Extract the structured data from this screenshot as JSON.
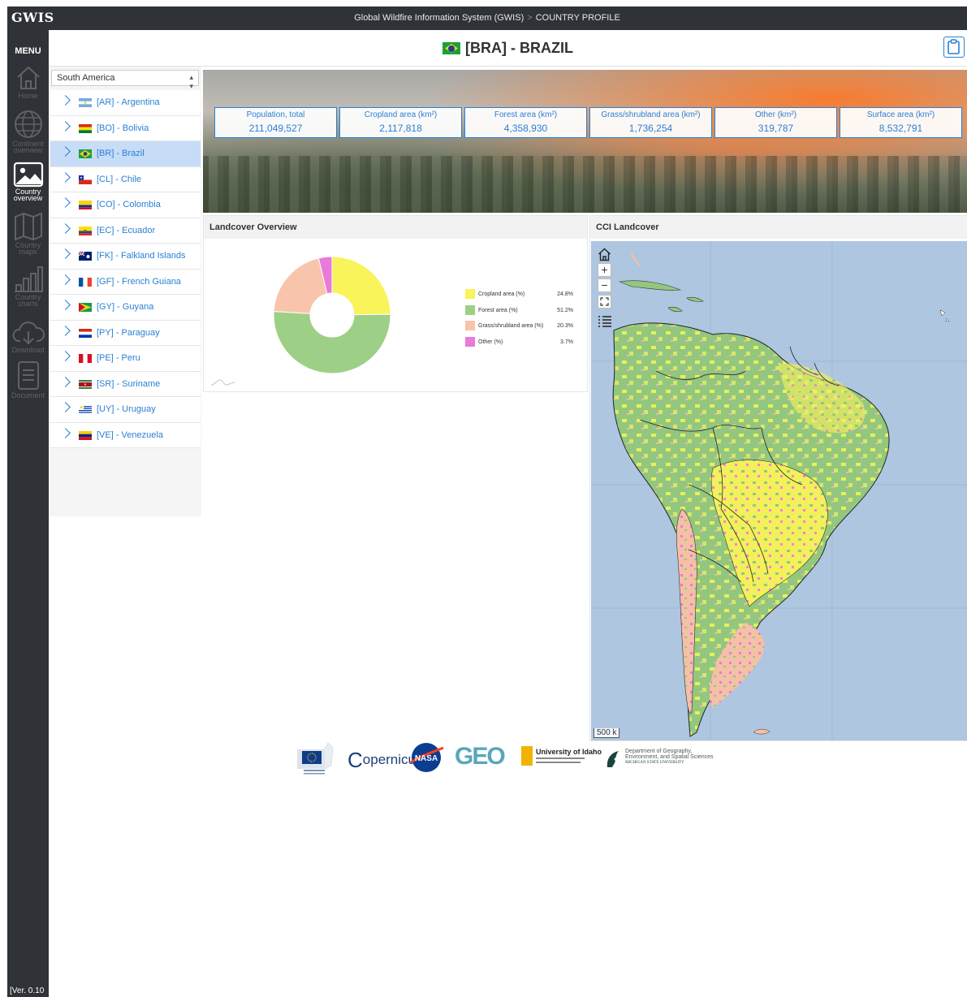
{
  "topbar": {
    "brand": "GWIS",
    "crumb_main": "Global Wildfire Information System (GWIS)",
    "crumb_sep": ">",
    "crumb_current": "COUNTRY PROFILE"
  },
  "sidebar": {
    "menu_label": "MENU",
    "items": [
      {
        "line1": "Home",
        "line2": "",
        "icon": "home-icon",
        "active": false
      },
      {
        "line1": "Continent",
        "line2": "overview",
        "icon": "globe-icon",
        "active": false
      },
      {
        "line1": "Country",
        "line2": "overview",
        "icon": "image-icon",
        "active": true
      },
      {
        "line1": "Country",
        "line2": "maps",
        "icon": "map-icon",
        "active": false
      },
      {
        "line1": "Country",
        "line2": "charts",
        "icon": "bar-chart-icon",
        "active": false
      },
      {
        "line1": "Download",
        "line2": "",
        "icon": "download-icon",
        "active": false
      },
      {
        "line1": "Document",
        "line2": "",
        "icon": "document-icon",
        "active": false
      }
    ],
    "version": "[Ver. 0.10"
  },
  "header": {
    "title": "[BRA] - BRAZIL"
  },
  "region_select": {
    "value": "South America"
  },
  "countries": [
    {
      "label": "[AR] - Argentina",
      "active": false
    },
    {
      "label": "[BO] - Bolivia",
      "active": false
    },
    {
      "label": "[BR] - Brazil",
      "active": true
    },
    {
      "label": "[CL] - Chile",
      "active": false
    },
    {
      "label": "[CO] - Colombia",
      "active": false
    },
    {
      "label": "[EC] - Ecuador",
      "active": false
    },
    {
      "label": "[FK] - Falkland Islands",
      "active": false
    },
    {
      "label": "[GF] - French Guiana",
      "active": false
    },
    {
      "label": "[GY] - Guyana",
      "active": false
    },
    {
      "label": "[PY] - Paraguay",
      "active": false
    },
    {
      "label": "[PE] - Peru",
      "active": false
    },
    {
      "label": "[SR] - Suriname",
      "active": false
    },
    {
      "label": "[UY] - Uruguay",
      "active": false
    },
    {
      "label": "[VE] - Venezuela",
      "active": false
    }
  ],
  "stats": [
    {
      "label": "Population, total",
      "value": "211,049,527"
    },
    {
      "label": "Cropland area (km²)",
      "value": "2,117,818"
    },
    {
      "label": "Forest area (km²)",
      "value": "4,358,930"
    },
    {
      "label": "Grass/shrubland area (km²)",
      "value": "1,736,254"
    },
    {
      "label": "Other (km²)",
      "value": "319,787"
    },
    {
      "label": "Surface area (km²)",
      "value": "8,532,791"
    }
  ],
  "landcover_card": {
    "title": "Landcover Overview"
  },
  "map_card": {
    "title": "CCI Landcover",
    "scale_label": "500 k"
  },
  "chart_data": {
    "type": "pie",
    "categories": [
      "Cropland area (%)",
      "Forest area (%)",
      "Grass/shrubland area (%)",
      "Other (%)"
    ],
    "values": [
      24.8,
      51.2,
      20.3,
      3.7
    ],
    "value_labels": [
      "24.8%",
      "51.2%",
      "20.3%",
      "3.7%"
    ],
    "colors": [
      "#f8f45a",
      "#9ecf86",
      "#f8c4ab",
      "#e97ad9"
    ],
    "donut": true,
    "legend": "right"
  },
  "footer_logos": {
    "copernicus": "opernicus",
    "nasa": "NASA",
    "geo": "GEO",
    "idaho": "University of Idaho",
    "msu_line1": "Department of Geography,",
    "msu_line2": "Environment, and Spatial Sciences",
    "msu_line3": "MICHIGAN STATE UNIVERSITY"
  },
  "colors": {
    "accent": "#2a7fd4",
    "sidebar_bg": "#2f3236",
    "active_row": "#c7dcf6",
    "ocean": "#aec6e0"
  }
}
